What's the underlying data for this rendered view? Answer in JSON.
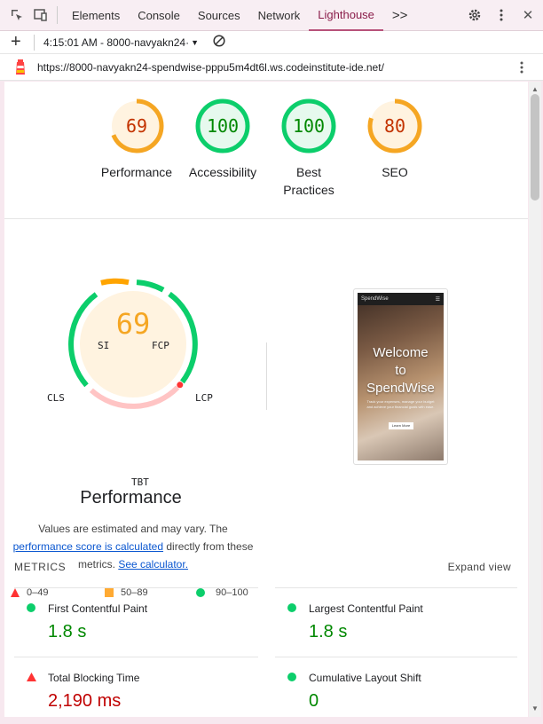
{
  "devtools": {
    "tabs": [
      "Elements",
      "Console",
      "Sources",
      "Network",
      "Lighthouse"
    ],
    "active_tab": "Lighthouse",
    "more_tabs": ">>"
  },
  "toolbar": {
    "add": "+",
    "report_select": "4:15:01 AM - 8000-navyakn24·",
    "url": "https://8000-navyakn24-spendwise-pppu5m4dt6l.ws.codeinstitute-ide.net/"
  },
  "scores": [
    {
      "label": "Performance",
      "value": 69,
      "color": "#f5a623",
      "text_color": "#c33300"
    },
    {
      "label": "Accessibility",
      "value": 100,
      "color": "#0cce6b",
      "text_color": "#008800"
    },
    {
      "label": "Best Practices",
      "value": 100,
      "color": "#0cce6b",
      "text_color": "#008800"
    },
    {
      "label": "SEO",
      "value": 80,
      "color": "#f5a623",
      "text_color": "#c33300"
    }
  ],
  "performance": {
    "score": "69",
    "title": "Performance",
    "segments": [
      "SI",
      "FCP",
      "LCP",
      "TBT",
      "CLS"
    ],
    "note_1": "Values are estimated and may vary. The",
    "note_link": "performance score is calculated",
    "note_2": "directly from these metrics.",
    "note_link2": "See calculator.",
    "legend": [
      {
        "range": "0–49",
        "color": "#ff3333"
      },
      {
        "range": "50–89",
        "color": "#ffaa33"
      },
      {
        "range": "90–100",
        "color": "#0cce6b"
      }
    ]
  },
  "screenshot": {
    "brand": "SpendWise",
    "heading_1": "Welcome",
    "heading_2": "to",
    "heading_3": "SpendWise",
    "subtext": "Track your expenses, manage your budget and achieve your financial goals with ease.",
    "button": "Learn More"
  },
  "metrics": {
    "header": "METRICS",
    "expand": "Expand view",
    "items": [
      {
        "name": "First Contentful Paint",
        "value": "1.8 s",
        "status": "pass"
      },
      {
        "name": "Largest Contentful Paint",
        "value": "1.8 s",
        "status": "pass"
      },
      {
        "name": "Total Blocking Time",
        "value": "2,190 ms",
        "status": "fail"
      },
      {
        "name": "Cumulative Layout Shift",
        "value": "0",
        "status": "pass"
      }
    ]
  }
}
